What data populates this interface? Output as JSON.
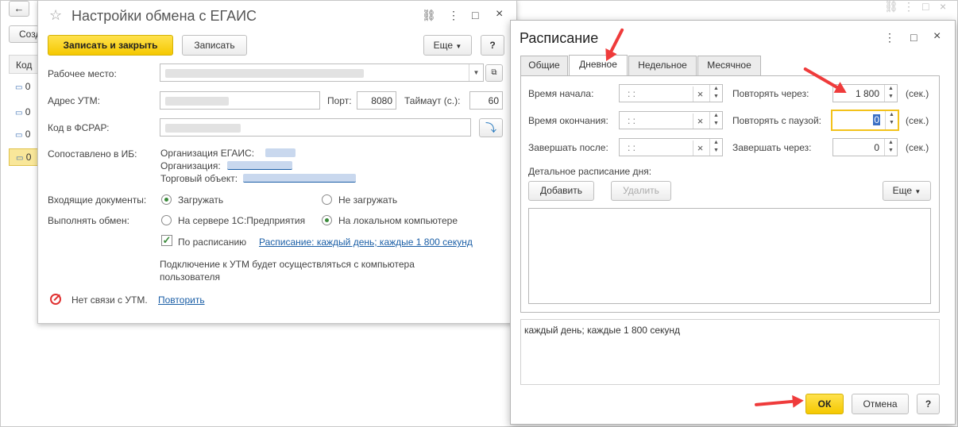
{
  "bg": {
    "back_arrow": "←",
    "create_button": "Созд",
    "column_code": "Код",
    "rows": [
      "0",
      "0",
      "0",
      "0"
    ]
  },
  "exchange": {
    "title": "Настройки обмена с ЕГАИС",
    "save_close": "Записать и закрыть",
    "save": "Записать",
    "more": "Еще",
    "help": "?",
    "workplace_label": "Рабочее место:",
    "utm_label": "Адрес УТМ:",
    "port_label": "Порт:",
    "port_value": "8080",
    "timeout_label": "Таймаут (с.):",
    "timeout_value": "60",
    "fsrar_label": "Код в ФСРАР:",
    "matched_label": "Сопоставлено в ИБ:",
    "org_egais": "Организация ЕГАИС:",
    "org": "Организация:",
    "trade_obj": "Торговый объект:",
    "incoming_label": "Входящие документы:",
    "load": "Загружать",
    "no_load": "Не загружать",
    "exec_label": "Выполнять обмен:",
    "on_server": "На сервере 1С:Предприятия",
    "on_local": "На локальном компьютере",
    "by_schedule": "По расписанию",
    "schedule_link": "Расписание: каждый день; каждые 1 800 секунд",
    "note": "Подключение к УТМ будет осуществляться с компьютера пользователя",
    "no_conn": "Нет связи с УТМ.",
    "retry": "Повторить"
  },
  "schedule": {
    "title": "Расписание",
    "tabs": [
      "Общие",
      "Дневное",
      "Недельное",
      "Месячное"
    ],
    "start_label": "Время начала:",
    "end_label": "Время окончания:",
    "finish_after_label": "Завершать после:",
    "time_placeholder": ":  :",
    "clear": "×",
    "repeat_label": "Повторять через:",
    "repeat_value": "1 800",
    "pause_label": "Повторять с паузой:",
    "pause_value": "0",
    "finish_through_label": "Завершать через:",
    "finish_through_value": "0",
    "unit": "(сек.)",
    "detail_label": "Детальное расписание дня:",
    "add": "Добавить",
    "delete": "Удалить",
    "more": "Еще",
    "summary": "каждый день; каждые 1 800 секунд",
    "ok": "ОК",
    "cancel": "Отмена",
    "help": "?"
  },
  "colors": {
    "accent_yellow": "#f5c800",
    "link_blue": "#1a5ea6",
    "annotation_red": "#ef3b3b",
    "check_green": "#3a8a3a"
  }
}
